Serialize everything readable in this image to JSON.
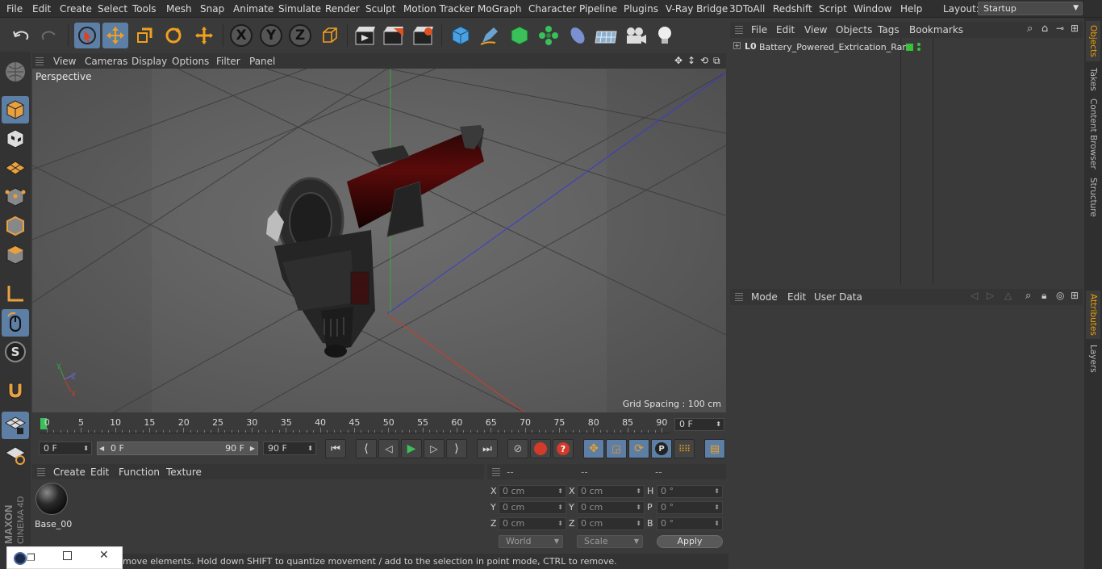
{
  "menu": [
    "File",
    "Edit",
    "Create",
    "Select",
    "Tools",
    "Mesh",
    "Snap",
    "Animate",
    "Simulate",
    "Render",
    "Sculpt",
    "Motion Tracker",
    "MoGraph",
    "Character",
    "Pipeline",
    "Plugins",
    "V-Ray Bridge",
    "3DToAll",
    "Redshift",
    "Script",
    "Window",
    "Help"
  ],
  "layout": {
    "label": "Layout:",
    "value": "Startup"
  },
  "toolbar": {
    "undo": "undo-icon",
    "redo": "redo-icon",
    "select": "live-selection-icon",
    "move": "move-icon",
    "scale": "scale-icon",
    "rotate": "rotate-icon",
    "recent": "recent-tool-icon",
    "axis_x": "X",
    "axis_y": "Y",
    "axis_z": "Z",
    "coord": "coordinate-system-icon",
    "render_view": "render-view-icon",
    "render_pv": "render-to-picture-viewer-icon",
    "render_settings": "render-settings-icon",
    "cube": "cube-icon",
    "pen": "pen-icon",
    "subdiv": "subdivision-icon",
    "cloner": "cloner-icon",
    "deformer": "deformer-icon",
    "floor": "floor-icon",
    "camera": "camera-icon",
    "light": "light-icon"
  },
  "viewport": {
    "menu": [
      "View",
      "Cameras",
      "Display",
      "Options",
      "Filter",
      "Panel"
    ],
    "label": "Perspective",
    "grid_spacing": "Grid Spacing : 100 cm",
    "axis_colors": {
      "x": "#d23a2a",
      "y": "#3aa83a",
      "z": "#3a3ad2"
    }
  },
  "timeline": {
    "ticks": [
      "0",
      "5",
      "10",
      "15",
      "20",
      "25",
      "30",
      "35",
      "40",
      "45",
      "50",
      "55",
      "60",
      "65",
      "70",
      "75",
      "80",
      "85",
      "90"
    ],
    "current": "0 F",
    "start": "0 F",
    "range_start": "0 F",
    "range_end": "90 F",
    "end": "90 F"
  },
  "materials": {
    "menu": [
      "Create",
      "Edit",
      "Function",
      "Texture"
    ],
    "items": [
      {
        "name": "Base_00"
      }
    ]
  },
  "coords": {
    "header": [
      "--",
      "--",
      "--"
    ],
    "rows": [
      {
        "l1": "X",
        "v1": "0 cm",
        "l2": "X",
        "v2": "0 cm",
        "l3": "H",
        "v3": "0 °"
      },
      {
        "l1": "Y",
        "v1": "0 cm",
        "l2": "Y",
        "v2": "0 cm",
        "l3": "P",
        "v3": "0 °"
      },
      {
        "l1": "Z",
        "v1": "0 cm",
        "l2": "Z",
        "v2": "0 cm",
        "l3": "B",
        "v3": "0 °"
      }
    ],
    "mode": "World",
    "scale": "Scale",
    "apply": "Apply"
  },
  "objects": {
    "menu": [
      "File",
      "Edit",
      "View",
      "Objects",
      "Tags",
      "Bookmarks"
    ],
    "items": [
      {
        "name": "Battery_Powered_Extrication_Ram"
      }
    ]
  },
  "attributes": {
    "menu": [
      "Mode",
      "Edit",
      "User Data"
    ]
  },
  "right_tabs": [
    "Objects",
    "Takes",
    "Content Browser",
    "Structure",
    "Attributes",
    "Layers"
  ],
  "status": "move elements. Hold down SHIFT to quantize movement / add to the selection in point mode, CTRL to remove.",
  "branding": {
    "line1": "MAXON",
    "line2": "CINEMA 4D"
  }
}
